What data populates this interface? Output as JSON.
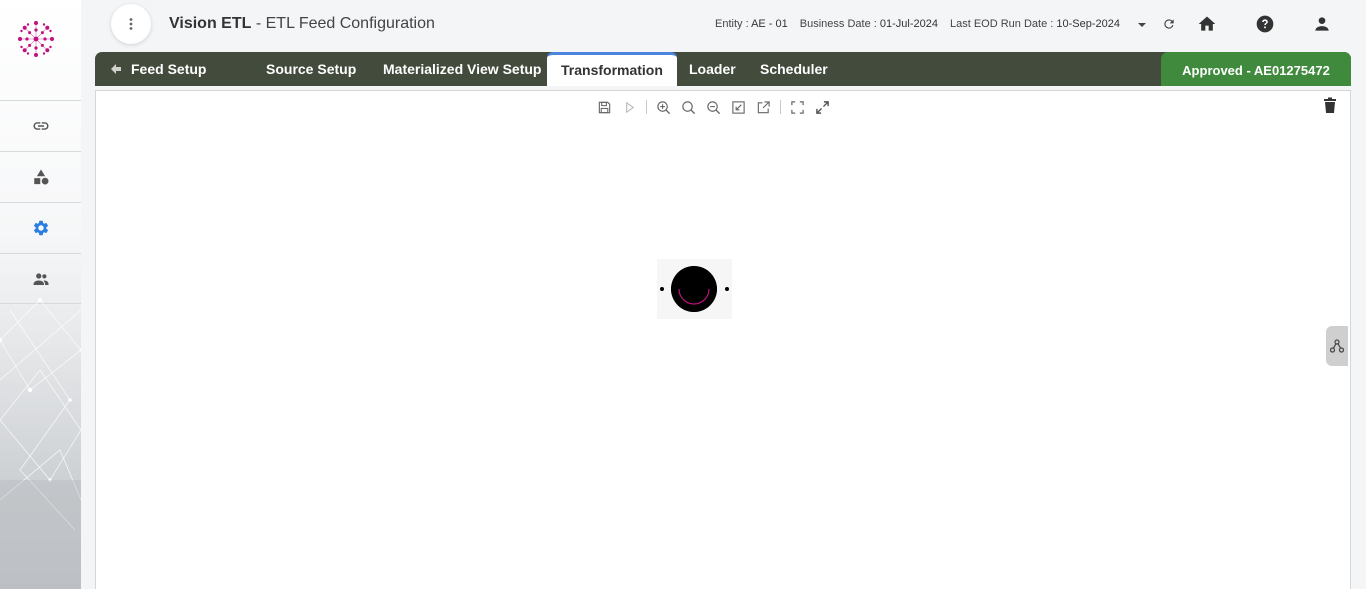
{
  "header": {
    "app_name": "Vision ETL",
    "page_title": "- ETL Feed Configuration",
    "entity_label": "Entity :",
    "entity_value": "AE - 01",
    "business_date_label": "Business Date :",
    "business_date_value": "01-Jul-2024",
    "eod_label": "Last EOD Run Date :",
    "eod_value": "10-Sep-2024"
  },
  "sidebar": {
    "items": [
      {
        "name": "link-icon",
        "active": false
      },
      {
        "name": "shapes-icon",
        "active": false
      },
      {
        "name": "gear-icon",
        "active": true
      },
      {
        "name": "users-icon",
        "active": false
      }
    ]
  },
  "tabs": {
    "back_label": "Feed Setup",
    "items": [
      {
        "label": "Source Setup"
      },
      {
        "label": "Materialized View Setup"
      },
      {
        "label": "Transformation"
      },
      {
        "label": "Loader"
      },
      {
        "label": "Scheduler"
      }
    ],
    "active_index": 2,
    "status": "Approved - AE01275472"
  },
  "toolbar": {
    "icons": [
      "save-icon",
      "run-icon",
      "zoom-in-icon",
      "zoom-reset-icon",
      "zoom-out-icon",
      "fit-icon",
      "open-external-icon",
      "fullscreen-icon",
      "expand-icon",
      "trash-icon"
    ]
  },
  "colors": {
    "tabbar": "#434b3d",
    "status_green": "#3f8a3c",
    "active_tab_border": "#4a86e0",
    "logo_magenta": "#c0117e",
    "active_sidebar_icon": "#2b7de0"
  }
}
